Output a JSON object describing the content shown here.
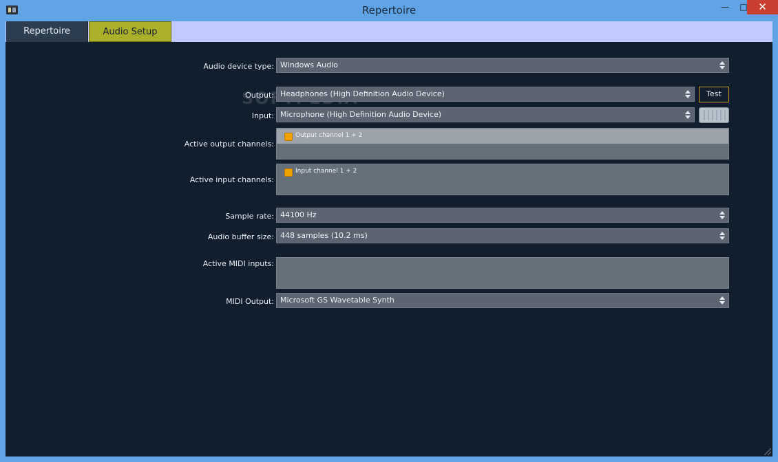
{
  "window": {
    "title": "Repertoire",
    "controls": {
      "minimize": "—",
      "maximize": "□",
      "close": "✕"
    }
  },
  "tabs": [
    {
      "label": "Repertoire",
      "active": false
    },
    {
      "label": "Audio Setup",
      "active": true
    }
  ],
  "watermark": "SOFTPEDIA",
  "audio_setup": {
    "device_type": {
      "label": "Audio device type:",
      "value": "Windows Audio"
    },
    "output": {
      "label": "Output:",
      "value": "Headphones (High Definition Audio Device)",
      "test_label": "Test"
    },
    "input": {
      "label": "Input:",
      "value": "Microphone (High Definition Audio Device)"
    },
    "active_output_channels": {
      "label": "Active output channels:",
      "items": [
        {
          "label": "Output channel 1 + 2",
          "checked": true
        }
      ]
    },
    "active_input_channels": {
      "label": "Active input channels:",
      "items": [
        {
          "label": "Input channel 1 + 2",
          "checked": true
        }
      ]
    },
    "sample_rate": {
      "label": "Sample rate:",
      "value": "44100 Hz"
    },
    "buffer_size": {
      "label": "Audio buffer size:",
      "value": "448 samples (10.2 ms)"
    },
    "active_midi_inputs": {
      "label": "Active MIDI inputs:"
    },
    "midi_output": {
      "label": "MIDI Output:",
      "value": "Microsoft GS Wavetable Synth"
    }
  },
  "colors": {
    "background": "#111e2d",
    "tabbar": "#c1c9fe",
    "active_tab": "#aab02a",
    "checkbox": "#f0a300",
    "close_button": "#c94033"
  }
}
